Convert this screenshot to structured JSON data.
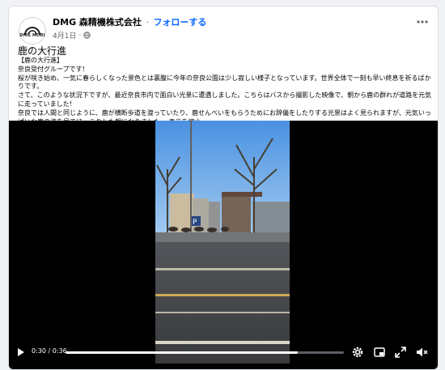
{
  "post": {
    "page_name": "DMG 森精機株式会社",
    "separator": "·",
    "follow_label": "フォローする",
    "date": "4月1日",
    "date_dot": "·",
    "avatar_text": "DMG MORI",
    "title": "鹿の大行進",
    "body_lines": [
      "【鹿の大行進】",
      "奈良受付グループです！",
      "桜が咲き始め、一気に春らしくなった景色とは裏腹に今年の奈良公園は少し寂しい様子となっています。世界全体で一刻も早い終息を祈るばかりです。",
      "さて、このような状況下ですが、最近奈良市内で面白い光景に遭遇しました。こちらはバスから撮影した映像で、朝から鹿の群れが道路を元気に走っていました！",
      "奈良では人間と同じように、鹿が横断歩道を渡っていたり、鹿せんべいをもらうためにお辞儀をしたりする光景はよく見られますが、元気いっぱいな鹿の姿を見てほっこりした朝になりました。"
    ],
    "see_less": "表示を縮小"
  },
  "video": {
    "time_display": "0:30 / 0:36",
    "progress": 0.833
  },
  "colors": {
    "accent": "#0866ff",
    "card_bg": "#ffffff",
    "page_bg": "#f0f2f5"
  }
}
